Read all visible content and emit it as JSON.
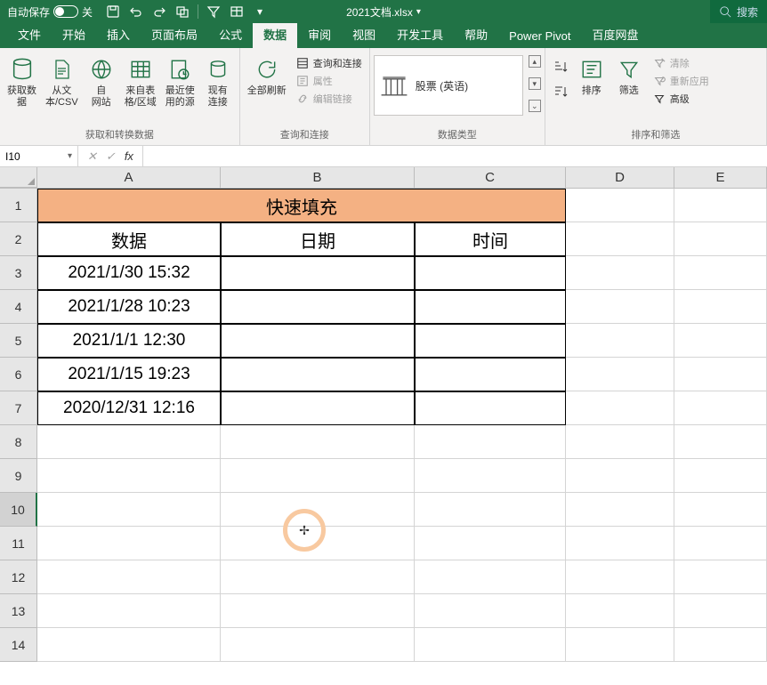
{
  "titlebar": {
    "auto_save": "自动保存",
    "auto_save_state": "关",
    "doc_name": "2021文档.xlsx",
    "search": "搜索"
  },
  "tabs": {
    "file": "文件",
    "home": "开始",
    "insert": "插入",
    "page_layout": "页面布局",
    "formulas": "公式",
    "data": "数据",
    "review": "审阅",
    "view": "视图",
    "developer": "开发工具",
    "help": "帮助",
    "power_pivot": "Power Pivot",
    "baidu": "百度网盘"
  },
  "ribbon": {
    "get_data": "获取数\n据",
    "from_csv": "从文\n本/CSV",
    "from_web": "自\n网站",
    "from_table": "来自表\n格/区域",
    "recent": "最近使\n用的源",
    "existing": "现有\n连接",
    "group1_label": "获取和转换数据",
    "refresh_all": "全部刷新",
    "queries": "查询和连接",
    "properties": "属性",
    "edit_links": "编辑链接",
    "group2_label": "查询和连接",
    "stock": "股票 (英语)",
    "group3_label": "数据类型",
    "sort": "排序",
    "filter": "筛选",
    "clear": "清除",
    "reapply": "重新应用",
    "advanced": "高级",
    "group4_label": "排序和筛选"
  },
  "namebox": "I10",
  "columns": {
    "a": "A",
    "b": "B",
    "c": "C",
    "d": "D",
    "e": "E"
  },
  "rows": [
    "1",
    "2",
    "3",
    "4",
    "5",
    "6",
    "7",
    "8",
    "9",
    "10",
    "11",
    "12",
    "13",
    "14"
  ],
  "sheet": {
    "title": "快速填充",
    "h_data": "数据",
    "h_date": "日期",
    "h_time": "时间",
    "r3": "2021/1/30 15:32",
    "r4": "2021/1/28 10:23",
    "r5": "2021/1/1 12:30",
    "r6": "2021/1/15 19:23",
    "r7": "2020/12/31 12:16"
  }
}
